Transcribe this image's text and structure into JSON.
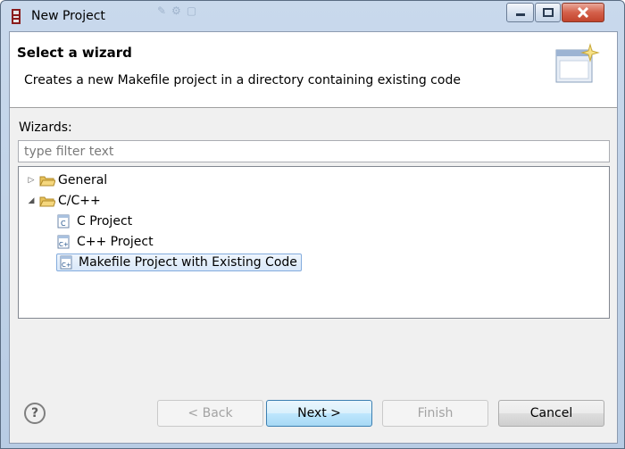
{
  "window": {
    "title": "New Project"
  },
  "banner": {
    "title": "Select a wizard",
    "description": "Creates a new Makefile project in a directory containing existing code"
  },
  "wizards": {
    "label": "Wizards:",
    "filter_placeholder": "type filter text",
    "filter_value": ""
  },
  "tree": {
    "items": [
      {
        "label": "General",
        "expanded": false,
        "icon": "folder-icon"
      },
      {
        "label": "C/C++",
        "expanded": true,
        "icon": "folder-icon"
      },
      {
        "label": "C Project",
        "icon": "c-project-icon"
      },
      {
        "label": "C++ Project",
        "icon": "cpp-project-icon"
      },
      {
        "label": "Makefile Project with Existing Code",
        "icon": "cpp-project-icon",
        "selected": true
      }
    ]
  },
  "buttons": {
    "help": "?",
    "back": "< Back",
    "next": "Next >",
    "finish": "Finish",
    "cancel": "Cancel"
  }
}
